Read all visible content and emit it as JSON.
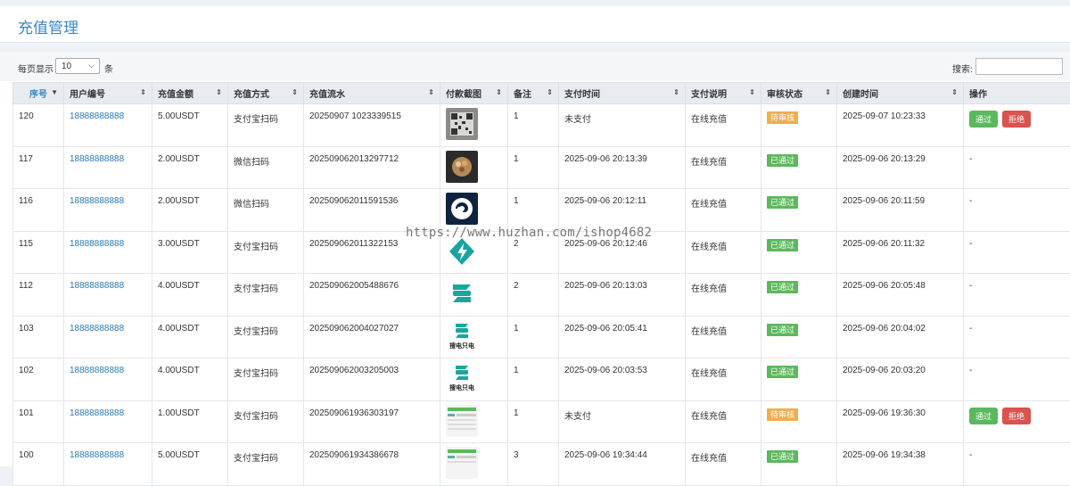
{
  "page": {
    "title": "充值管理"
  },
  "toolbar": {
    "per_page_label": "每页显示",
    "per_page_value": "10",
    "per_page_unit": "条",
    "search_label": "搜索:"
  },
  "table": {
    "headers": [
      "序号",
      "用户编号",
      "充值金额",
      "充值方式",
      "充值流水",
      "付款截图",
      "备注",
      "支付时间",
      "支付说明",
      "审核状态",
      "创建时间",
      "操作"
    ],
    "rows": [
      {
        "id": "120",
        "user": "18888888888",
        "amount": "5.00USDT",
        "method": "支付宝扫码",
        "serial": "20250907 1023339515",
        "remark": "1",
        "pay_time": "未支付",
        "desc": "在线充值",
        "status": "待审核",
        "created": "2025-09-07 10:23:33",
        "actions": [
          "通过",
          "拒绝"
        ]
      },
      {
        "id": "117",
        "user": "18888888888",
        "amount": "2.00USDT",
        "method": "微信扫码",
        "serial": "202509062013297712",
        "remark": "1",
        "pay_time": "2025-09-06 20:13:39",
        "desc": "在线充值",
        "status": "已通过",
        "created": "2025-09-06 20:13:29",
        "op": "-"
      },
      {
        "id": "116",
        "user": "18888888888",
        "amount": "2.00USDT",
        "method": "微信扫码",
        "serial": "202509062011591536",
        "remark": "1",
        "pay_time": "2025-09-06 20:12:11",
        "desc": "在线充值",
        "status": "已通过",
        "created": "2025-09-06 20:11:59",
        "op": "-"
      },
      {
        "id": "115",
        "user": "18888888888",
        "amount": "3.00USDT",
        "method": "支付宝扫码",
        "serial": "202509062011322153",
        "remark": "2",
        "pay_time": "2025-09-06 20:12:46",
        "desc": "在线充值",
        "status": "已通过",
        "created": "2025-09-06 20:11:32",
        "op": "-"
      },
      {
        "id": "112",
        "user": "18888888888",
        "amount": "4.00USDT",
        "method": "支付宝扫码",
        "serial": "202509062005488676",
        "remark": "2",
        "pay_time": "2025-09-06 20:13:03",
        "desc": "在线充值",
        "status": "已通过",
        "created": "2025-09-06 20:05:48",
        "op": "-"
      },
      {
        "id": "103",
        "user": "18888888888",
        "amount": "4.00USDT",
        "method": "支付宝扫码",
        "serial": "202509062004027027",
        "remark": "1",
        "pay_time": "2025-09-06 20:05:41",
        "desc": "在线充值",
        "status": "已通过",
        "created": "2025-09-06 20:04:02",
        "op": "-"
      },
      {
        "id": "102",
        "user": "18888888888",
        "amount": "4.00USDT",
        "method": "支付宝扫码",
        "serial": "202509062003205003",
        "remark": "1",
        "pay_time": "2025-09-06 20:03:53",
        "desc": "在线充值",
        "status": "已通过",
        "created": "2025-09-06 20:03:20",
        "op": "-"
      },
      {
        "id": "101",
        "user": "18888888888",
        "amount": "1.00USDT",
        "method": "支付宝扫码",
        "serial": "202509061936303197",
        "remark": "1",
        "pay_time": "未支付",
        "desc": "在线充值",
        "status": "待审核",
        "created": "2025-09-06 19:36:30",
        "actions": [
          "通过",
          "拒绝"
        ]
      },
      {
        "id": "100",
        "user": "18888888888",
        "amount": "5.00USDT",
        "method": "支付宝扫码",
        "serial": "202509061934386678",
        "remark": "3",
        "pay_time": "2025-09-06 19:34:44",
        "desc": "在线充值",
        "status": "已通过",
        "created": "2025-09-06 19:34:38",
        "op": "-"
      }
    ]
  },
  "thumb_labels": {
    "charge_logo_text": "搜电只电"
  },
  "watermark": "https://www.huzhan.com/ishop4682",
  "colors": {
    "accent": "#3a87c8",
    "pending": "#f0ad4e",
    "passed": "#5cb85c",
    "reject": "#d9534f"
  }
}
